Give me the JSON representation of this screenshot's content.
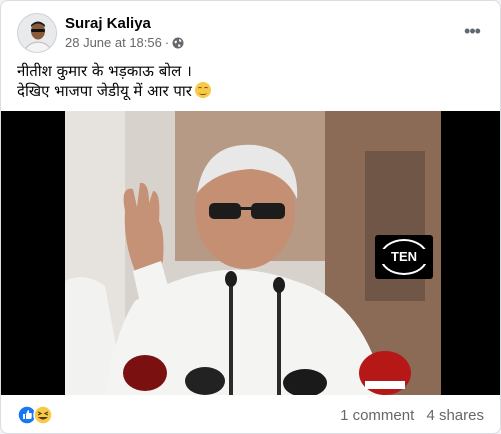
{
  "post": {
    "author": "Suraj Kaliya",
    "date": "28 June at 18:56",
    "separator": "·",
    "privacy_icon": "globe-icon",
    "more_icon": "ellipsis-icon",
    "text_line1": "नीतीश कुमार के भड़काऊ बोल ।",
    "text_line2": "देखिए भाजपा जेडीयू में आर पार",
    "text_emoji": "relieved-face-emoji"
  },
  "video": {
    "watermark": "TEN"
  },
  "footer": {
    "reaction_icons": [
      "like-icon",
      "haha-icon"
    ],
    "comments": "1 comment",
    "shares": "4 shares"
  },
  "colors": {
    "like_blue": "#1877f2",
    "haha_yellow": "#f7c948",
    "secondary_text": "#65676b"
  }
}
